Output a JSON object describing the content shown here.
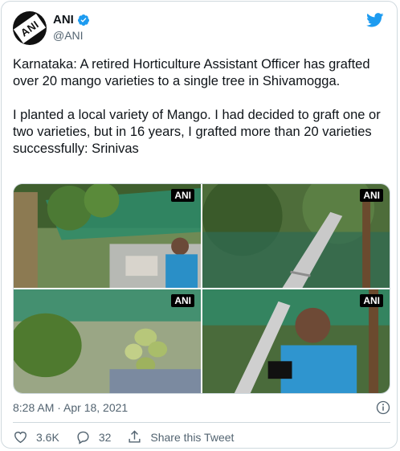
{
  "author": {
    "display_name": "ANI",
    "handle": "@ANI",
    "avatar_text": "ANI"
  },
  "tweet": {
    "text": "Karnataka: A retired Horticulture Assistant Officer has grafted over 20 mango varieties to a single tree in Shivamogga.\n\nI planted a local variety of Mango. I had decided to graft one or two varieties, but in 16 years, I grafted more than 20 varieties successfully: Srinivas",
    "timestamp": "8:28 AM · Apr 18, 2021"
  },
  "media": {
    "watermarks": [
      "ANI",
      "ANI",
      "ANI",
      "ANI"
    ]
  },
  "actions": {
    "likes": "3.6K",
    "replies": "32",
    "share_label": "Share this Tweet"
  },
  "colors": {
    "twitter_blue": "#1d9bf0",
    "secondary_text": "#536471",
    "border": "#cfd9de"
  },
  "icons": [
    "verified-badge-icon",
    "twitter-bird-icon",
    "info-icon",
    "heart-icon",
    "reply-icon",
    "share-icon"
  ]
}
